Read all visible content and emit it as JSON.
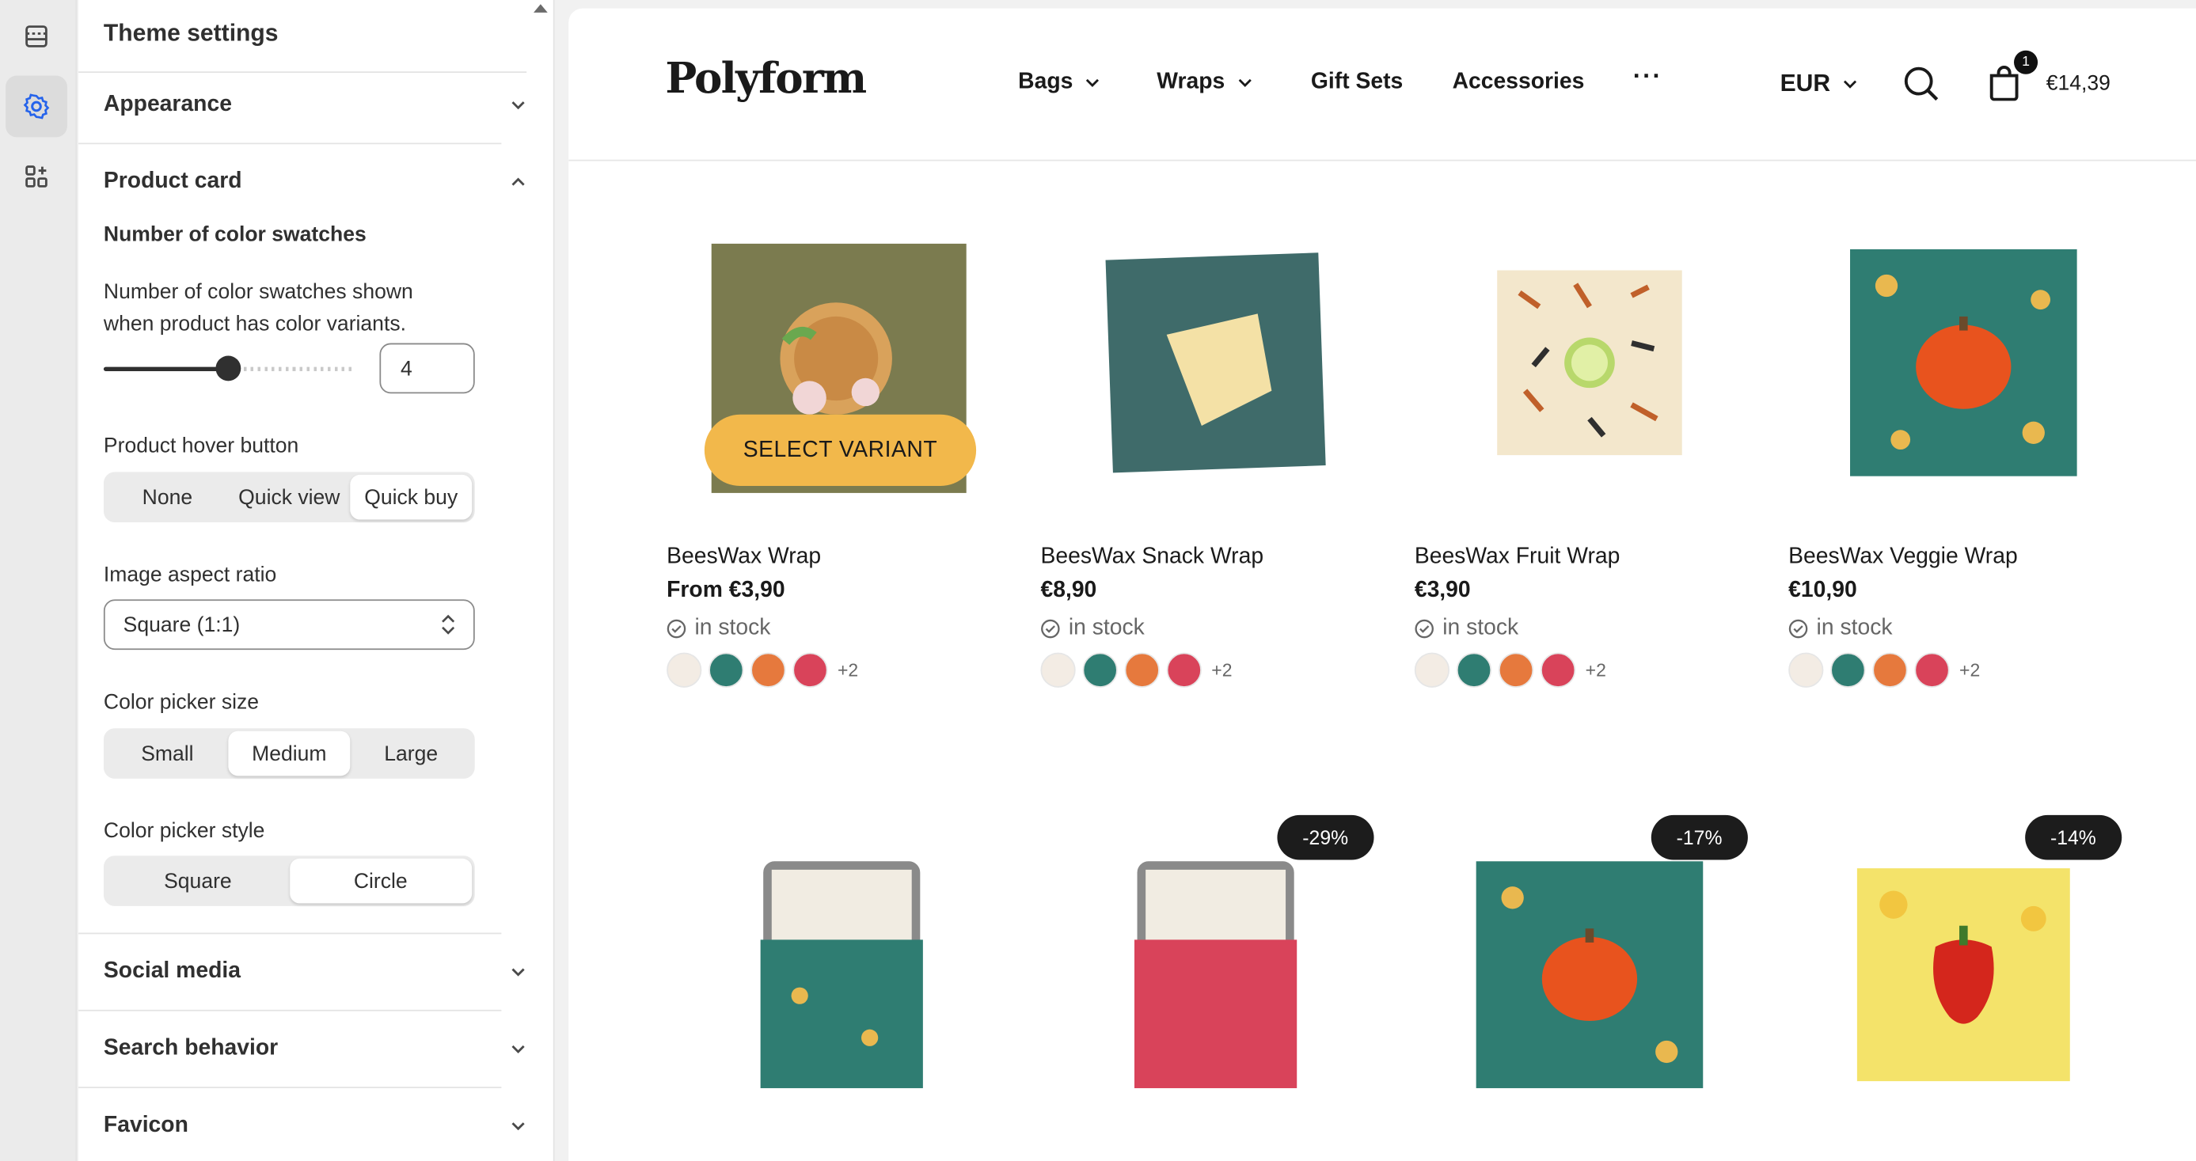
{
  "sidebar": {
    "title": "Theme settings",
    "sections": {
      "appearance": "Appearance",
      "product_card": "Product card",
      "social_media": "Social media",
      "search_behavior": "Search behavior",
      "favicon": "Favicon"
    },
    "swatches": {
      "heading": "Number of color swatches",
      "help": "Number of color swatches shown when product has color variants.",
      "value": "4",
      "slider_fraction": 0.5
    },
    "hover_button": {
      "label": "Product hover button",
      "options": [
        "None",
        "Quick view",
        "Quick buy"
      ],
      "selected": "Quick buy"
    },
    "aspect_ratio": {
      "label": "Image aspect ratio",
      "value": "Square (1:1)"
    },
    "picker_size": {
      "label": "Color picker size",
      "options": [
        "Small",
        "Medium",
        "Large"
      ],
      "selected": "Medium"
    },
    "picker_style": {
      "label": "Color picker style",
      "options": [
        "Square",
        "Circle"
      ],
      "selected": "Circle"
    }
  },
  "store": {
    "logo": "Polyform",
    "nav": [
      "Bags",
      "Wraps",
      "Gift Sets",
      "Accessories"
    ],
    "currency": "EUR",
    "cart_count": "1",
    "cart_total": "€14,39"
  },
  "products": [
    {
      "name": "BeesWax Wrap",
      "price": "From €3,90",
      "stock": "in stock",
      "more": "+2"
    },
    {
      "name": "BeesWax Snack Wrap",
      "price": "€8,90",
      "stock": "in stock",
      "more": "+2"
    },
    {
      "name": "BeesWax Fruit Wrap",
      "price": "€3,90",
      "stock": "in stock",
      "more": "+2"
    },
    {
      "name": "BeesWax Veggie Wrap",
      "price": "€10,90",
      "stock": "in stock",
      "more": "+2"
    }
  ],
  "select_variant_label": "SELECT VARIANT",
  "badges": [
    "-29%",
    "-17%",
    "-14%"
  ],
  "colors": {
    "accent": "#f2b84b",
    "wrap_olive": "#7b7b4f",
    "wrap_teal": "#3f6b6a",
    "wrap_cream": "#f3e7cc",
    "wrap_green": "#2f7d72",
    "wrap_red": "#d9435a",
    "wrap_yellow": "#f4e36a"
  }
}
